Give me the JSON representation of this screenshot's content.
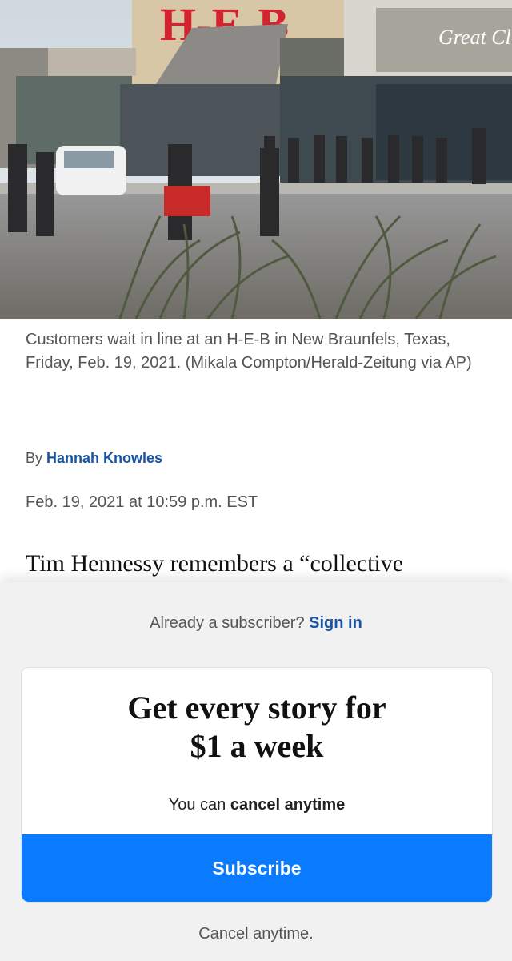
{
  "photo": {
    "alt": "Customers wait in line outside an H-E-B store",
    "store_sign": "H-E-B",
    "neighbor_sign": "Great Clips"
  },
  "caption": "Customers wait in line at an H-E-B in New Braunfels, Texas, Friday, Feb. 19, 2021. (Mikala Compton/Herald-Zeitung via AP)",
  "byline": {
    "prefix": "By",
    "author": "Hannah Knowles"
  },
  "date": "Feb. 19, 2021 at 10:59 p.m. EST",
  "lede": "Tim Hennessy remembers a “collective",
  "paywall": {
    "already_text": "Already a subscriber?",
    "sign_in": "Sign in",
    "headline_line1": "Get every story for",
    "headline_line2": "$1 a week",
    "cancel_prefix": "You can",
    "cancel_bold": "cancel anytime",
    "subscribe_label": "Subscribe",
    "footer": "Cancel anytime."
  },
  "colors": {
    "link": "#1955a5",
    "subscribe_bg": "#0a7bff",
    "overlay_bg": "#f1f1f1"
  }
}
